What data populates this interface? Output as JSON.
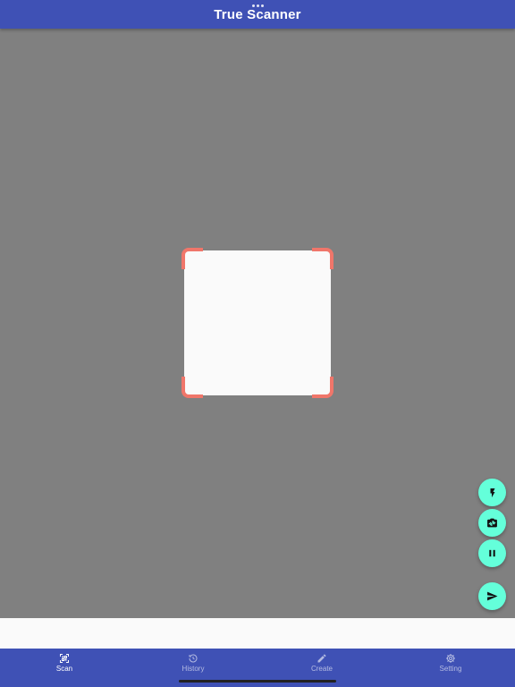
{
  "header": {
    "title": "True Scanner"
  },
  "scanner": {
    "corner_color": "#f0766a",
    "window_color": "#fafafa"
  },
  "fabs": [
    {
      "name": "flash-button",
      "icon": "flash-icon"
    },
    {
      "name": "switch-camera-button",
      "icon": "switch-camera-icon"
    },
    {
      "name": "pause-button",
      "icon": "pause-icon"
    },
    {
      "name": "send-button",
      "icon": "send-icon"
    }
  ],
  "nav": {
    "items": [
      {
        "label": "Scan",
        "icon": "qr-scan-icon",
        "active": true
      },
      {
        "label": "History",
        "icon": "history-icon",
        "active": false
      },
      {
        "label": "Create",
        "icon": "pencil-icon",
        "active": false
      },
      {
        "label": "Setting",
        "icon": "gear-icon",
        "active": false
      }
    ]
  },
  "colors": {
    "primary": "#3f51b5",
    "accent": "#64ffda",
    "camera_bg": "#808080"
  }
}
